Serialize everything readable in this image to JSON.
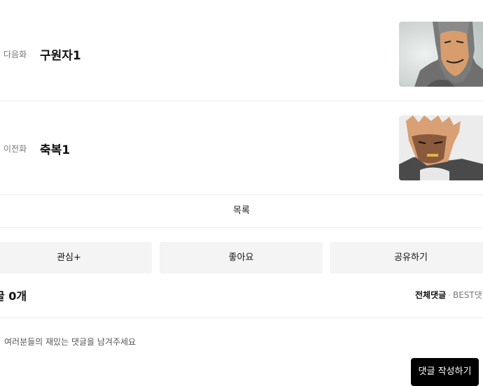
{
  "episodes": {
    "next": {
      "tag": "다음화",
      "title": "구원자1"
    },
    "prev": {
      "tag": "이전화",
      "title": "축복1"
    }
  },
  "list_label": "목록",
  "actions": {
    "interest": "관심+",
    "like": "좋아요",
    "share": "공유하기"
  },
  "comments": {
    "count_label": "글 0개",
    "sort_all": "전체댓글",
    "sort_separator": "·",
    "sort_best": "BEST댓",
    "placeholder": "여러분들의 재밌는 댓글을 남겨주세요",
    "submit_label": "댓글 작성하기"
  }
}
